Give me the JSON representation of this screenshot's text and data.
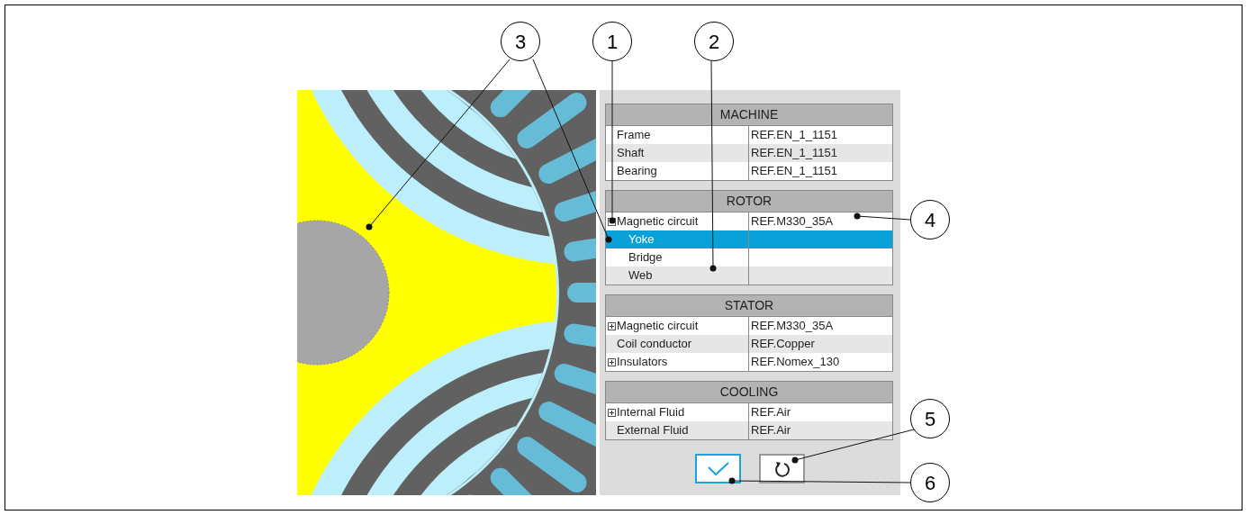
{
  "sections": [
    {
      "title": "MACHINE",
      "rows": [
        {
          "name": "Frame",
          "value": "REF.EN_1_1151",
          "selected": false
        },
        {
          "name": "Shaft",
          "value": "REF.EN_1_1151",
          "selected": false
        },
        {
          "name": "Bearing",
          "value": "REF.EN_1_1151",
          "selected": false
        }
      ]
    },
    {
      "title": "ROTOR",
      "rows": [
        {
          "name": "Magnetic circuit",
          "value": "REF.M330_35A",
          "selected": false,
          "expanded": true,
          "children": [
            {
              "name": "Yoke",
              "selected": true
            },
            {
              "name": "Bridge",
              "selected": false
            },
            {
              "name": "Web",
              "selected": false
            }
          ]
        }
      ]
    },
    {
      "title": "STATOR",
      "rows": [
        {
          "name": "Magnetic circuit",
          "value": "REF.M330_35A",
          "selected": false,
          "expanded": false
        },
        {
          "name": "Coil conductor",
          "value": "REF.Copper",
          "selected": false
        },
        {
          "name": "Insulators",
          "value": "REF.Nomex_130",
          "selected": false,
          "expanded": false
        }
      ]
    },
    {
      "title": "COOLING",
      "rows": [
        {
          "name": "Internal Fluid",
          "value": "REF.Air",
          "selected": false,
          "expanded": false
        },
        {
          "name": "External Fluid",
          "value": "REF.Air",
          "selected": false
        }
      ]
    }
  ],
  "buttons": [
    {
      "kind": "apply",
      "selected": true
    },
    {
      "kind": "reset",
      "selected": false
    }
  ],
  "callouts": [
    "3",
    "1",
    "2",
    "4",
    "5",
    "6"
  ]
}
